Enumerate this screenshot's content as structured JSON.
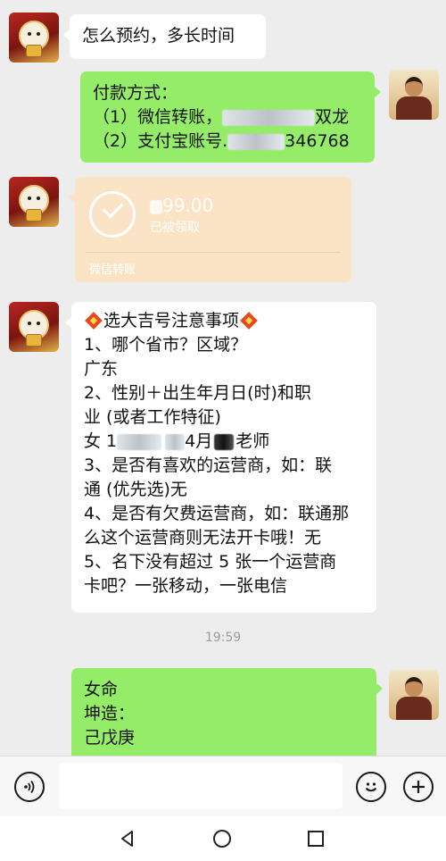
{
  "messages": {
    "m1": {
      "text": "怎么预约，多长时间"
    },
    "m2": {
      "line1": "付款方式：",
      "line2_prefix": "（1）微信转账，",
      "line2_suffix": "双龙",
      "line3_prefix": "（2）支付宝账号.",
      "line3_suffix": "346768"
    },
    "transfer": {
      "amount_suffix": "99.00",
      "status": "已被领取",
      "kind": "微信转账"
    },
    "m4": {
      "title": "选大吉号注意事项",
      "lines": [
        "1、哪个省市？区域？",
        "广东",
        "2、性别＋出生年月日(时)和职",
        "业 (或者工作特征)"
      ],
      "line_female_a": "女 1",
      "line_female_b": "4月",
      "line_female_c": "老师",
      "lines2": [
        "3、是否有喜欢的运营商，如：联",
        "通 (优先选)无",
        "4、是否有欠费运营商，如：联通那",
        "么这个运营商则无法开卡哦！无",
        "5、名下没有超过 5 张一个运营商",
        "卡吧？一张移动，一张电信"
      ]
    },
    "time": "19:59",
    "m5": {
      "lines": [
        "女命",
        "坤造：",
        "己戊庚"
      ]
    }
  },
  "input": {
    "value": ""
  },
  "icons": {
    "voice": "voice-icon",
    "emoji": "emoji-icon",
    "plus": "plus-icon",
    "back": "back-icon",
    "home": "home-icon",
    "recents": "recents-icon"
  },
  "colors": {
    "chat_bg": "#ededed",
    "green_bubble": "#95ec69",
    "transfer_bg": "#fbe3c6"
  }
}
